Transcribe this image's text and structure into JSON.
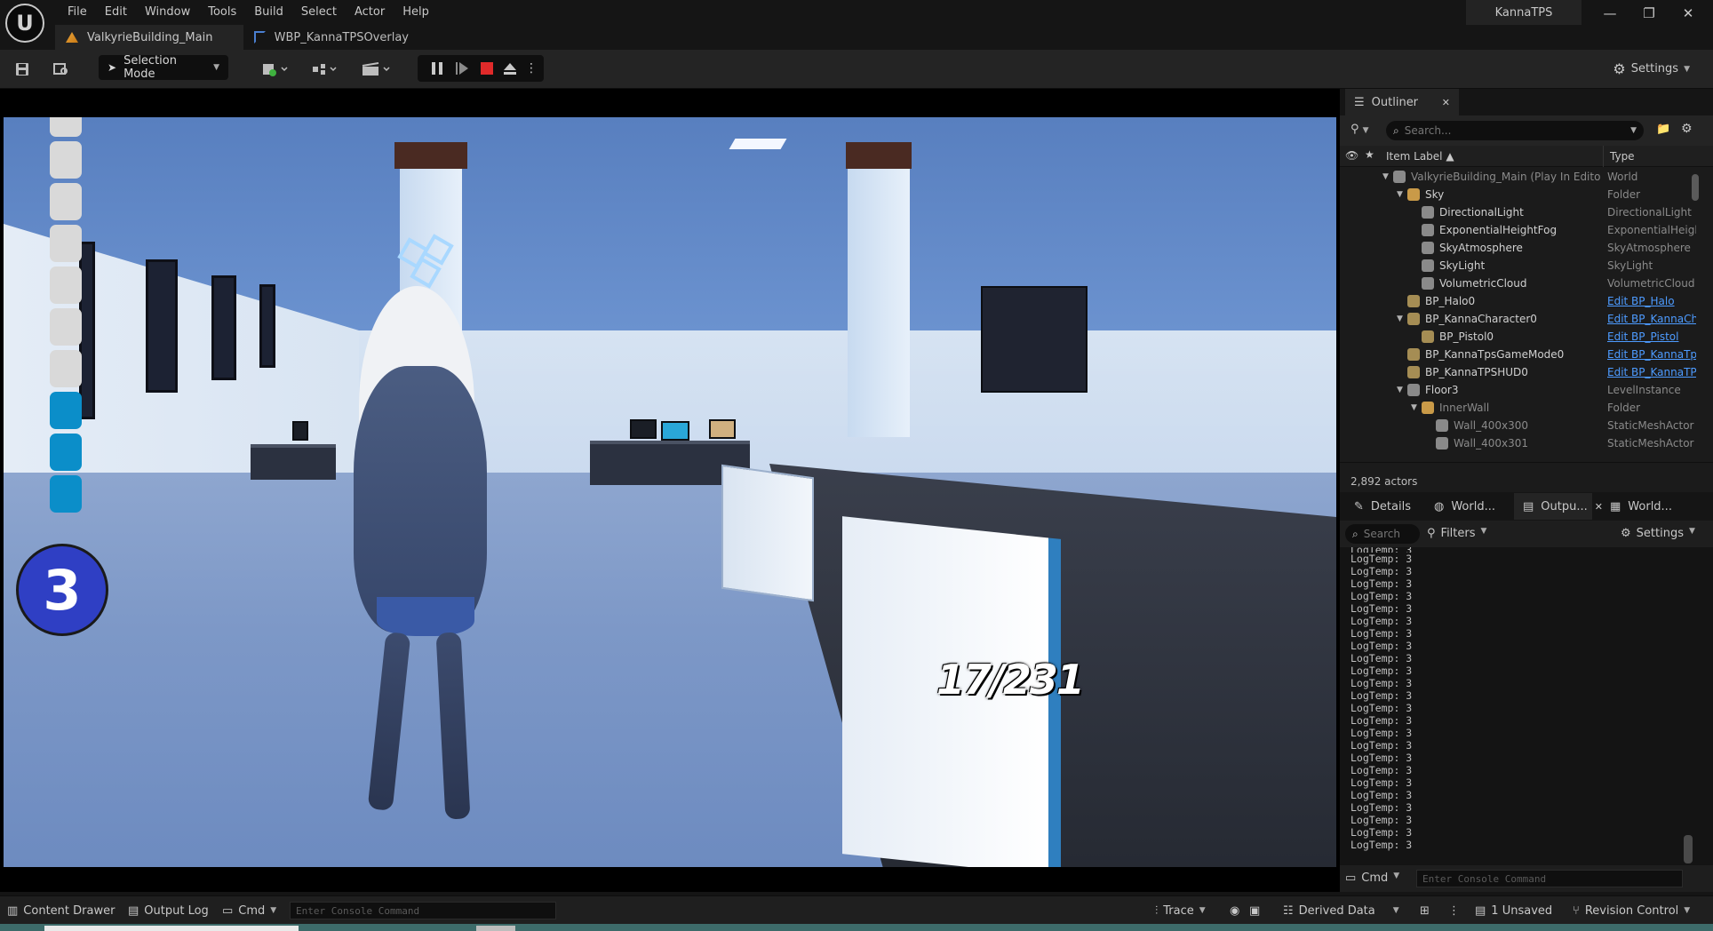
{
  "app": {
    "project_name": "KannaTPS",
    "menu": [
      "File",
      "Edit",
      "Window",
      "Tools",
      "Build",
      "Select",
      "Actor",
      "Help"
    ],
    "tabs": [
      {
        "label": "ValkyrieBuilding_Main",
        "active": true
      },
      {
        "label": "WBP_KannaTPSOverlay",
        "active": false
      }
    ],
    "window_controls": {
      "minimize": "—",
      "restore": "❐",
      "close": "✕"
    }
  },
  "toolbar": {
    "selection_mode": "Selection Mode",
    "settings": "Settings"
  },
  "hud": {
    "health_segments_total": 10,
    "health_segments_filled": 3,
    "weapon_index": "3",
    "ammo": "17/231"
  },
  "outliner": {
    "tab_label": "Outliner",
    "search_placeholder": "Search...",
    "col_item_label": "Item Label ▲",
    "col_type": "Type",
    "items": [
      {
        "label": "ValkyrieBuilding_Main (Play In Editor)",
        "type": "World",
        "indent": 0,
        "expanded": true,
        "dim": true
      },
      {
        "label": "Sky",
        "type": "Folder",
        "indent": 1,
        "expanded": true
      },
      {
        "label": "DirectionalLight",
        "type": "DirectionalLight",
        "indent": 2
      },
      {
        "label": "ExponentialHeightFog",
        "type": "ExponentialHeightFog",
        "indent": 2
      },
      {
        "label": "SkyAtmosphere",
        "type": "SkyAtmosphere",
        "indent": 2
      },
      {
        "label": "SkyLight",
        "type": "SkyLight",
        "indent": 2
      },
      {
        "label": "VolumetricCloud",
        "type": "VolumetricCloud",
        "indent": 2
      },
      {
        "label": "BP_Halo0",
        "type": "Edit BP_Halo",
        "indent": 1,
        "link": true
      },
      {
        "label": "BP_KannaCharacter0",
        "type": "Edit BP_KannaCharacter",
        "indent": 1,
        "expanded": true,
        "link": true
      },
      {
        "label": "BP_Pistol0",
        "type": "Edit BP_Pistol",
        "indent": 2,
        "link": true
      },
      {
        "label": "BP_KannaTpsGameMode0",
        "type": "Edit BP_KannaTpsGameMode",
        "indent": 1,
        "link": true
      },
      {
        "label": "BP_KannaTPSHUD0",
        "type": "Edit BP_KannaTPSHUD",
        "indent": 1,
        "link": true
      },
      {
        "label": "Floor3",
        "type": "LevelInstance",
        "indent": 1,
        "expanded": true
      },
      {
        "label": "InnerWall",
        "type": "Folder",
        "indent": 2,
        "expanded": true,
        "dim": true
      },
      {
        "label": "Wall_400x300",
        "type": "StaticMeshActor",
        "indent": 3,
        "dim": true
      },
      {
        "label": "Wall_400x301",
        "type": "StaticMeshActor",
        "indent": 3,
        "dim": true
      }
    ],
    "actor_count": "2,892 actors"
  },
  "panels2": {
    "tabs": [
      "Details",
      "World...",
      "Outpu...",
      "World..."
    ],
    "search_placeholder": "Search",
    "filters": "Filters",
    "settings": "Settings",
    "log_first": "LogTemp: 3",
    "log_lines": [
      "LogTemp: 3",
      "LogTemp: 3",
      "LogTemp: 3",
      "LogTemp: 3",
      "LogTemp: 3",
      "LogTemp: 3",
      "LogTemp: 3",
      "LogTemp: 3",
      "LogTemp: 3",
      "LogTemp: 3",
      "LogTemp: 3",
      "LogTemp: 3",
      "LogTemp: 3",
      "LogTemp: 3",
      "LogTemp: 3",
      "LogTemp: 3",
      "LogTemp: 3",
      "LogTemp: 3",
      "LogTemp: 3",
      "LogTemp: 3",
      "LogTemp: 3",
      "LogTemp: 3",
      "LogTemp: 3",
      "LogTemp: 3"
    ],
    "cmd_label": "Cmd",
    "cmd_placeholder": "Enter Console Command"
  },
  "statusbar": {
    "content_drawer": "Content Drawer",
    "output_log": "Output Log",
    "cmd": "Cmd",
    "cmd_placeholder": "Enter Console Command",
    "trace": "Trace",
    "derived_data": "Derived Data",
    "unsaved": "1 Unsaved",
    "revision_control": "Revision Control"
  },
  "colors": {
    "hud_filled": "#0b8ec9",
    "hud_empty": "#d9d9d9",
    "ammo_circle": "#2f3fc4",
    "link": "#4d9bff",
    "stop": "#e02a2a"
  }
}
